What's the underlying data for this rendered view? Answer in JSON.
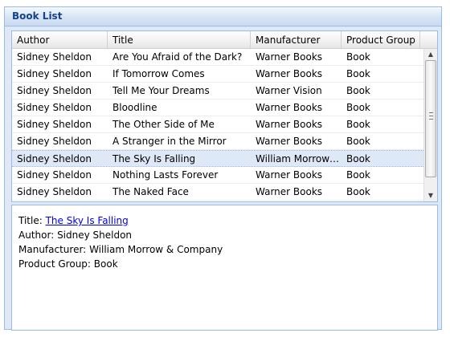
{
  "panel": {
    "title": "Book List"
  },
  "grid": {
    "columns": [
      "Author",
      "Title",
      "Manufacturer",
      "Product Group"
    ],
    "rows": [
      [
        "Sidney Sheldon",
        "Are You Afraid of the Dark?",
        "Warner Books",
        "Book"
      ],
      [
        "Sidney Sheldon",
        "If Tomorrow Comes",
        "Warner Books",
        "Book"
      ],
      [
        "Sidney Sheldon",
        "Tell Me Your Dreams",
        "Warner Vision",
        "Book"
      ],
      [
        "Sidney Sheldon",
        "Bloodline",
        "Warner Books",
        "Book"
      ],
      [
        "Sidney Sheldon",
        "The Other Side of Me",
        "Warner Books",
        "Book"
      ],
      [
        "Sidney Sheldon",
        "A Stranger in the Mirror",
        "Warner Books",
        "Book"
      ],
      [
        "Sidney Sheldon",
        "The Sky Is Falling",
        "William Morrow ...",
        "Book"
      ],
      [
        "Sidney Sheldon",
        "Nothing Lasts Forever",
        "Warner Books",
        "Book"
      ],
      [
        "Sidney Sheldon",
        "The Naked Face",
        "Warner Books",
        "Book"
      ]
    ],
    "selected_row": 6
  },
  "detail": {
    "title_label": "Title:",
    "title_value": "The Sky Is Falling",
    "author_label": "Author:",
    "author_value": "Sidney Sheldon",
    "manufacturer_label": "Manufacturer:",
    "manufacturer_value": "William Morrow & Company",
    "group_label": "Product Group:",
    "group_value": "Book"
  },
  "icons": {
    "scroll_up": "scroll-up-arrow",
    "scroll_down": "scroll-down-arrow"
  }
}
